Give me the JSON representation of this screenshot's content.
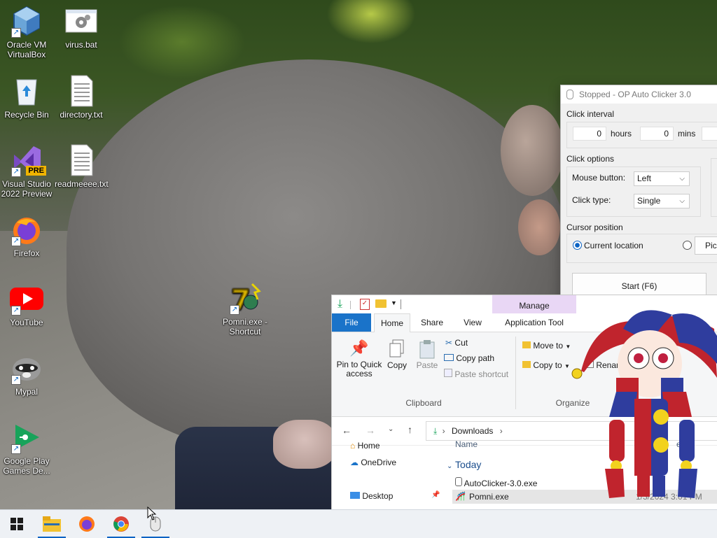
{
  "desktop": {
    "icons": [
      {
        "label": "Oracle VM VirtualBox",
        "icon": "virtualbox-icon"
      },
      {
        "label": "virus.bat",
        "icon": "batch-file-icon"
      },
      {
        "label": "Recycle Bin",
        "icon": "recycle-bin-icon"
      },
      {
        "label": "directory.txt",
        "icon": "text-file-icon"
      },
      {
        "label": "Visual Studio 2022 Preview",
        "icon": "visual-studio-icon"
      },
      {
        "label": "readmeeee.txt",
        "icon": "text-file-icon"
      },
      {
        "label": "Firefox",
        "icon": "firefox-icon"
      },
      {
        "label": "YouTube",
        "icon": "youtube-icon"
      },
      {
        "label": "Pomni.exe - Shortcut",
        "icon": "pomni-exe-icon"
      },
      {
        "label": "Mypal",
        "icon": "mypal-icon"
      },
      {
        "label": "Google Play Games De...",
        "icon": "google-play-games-icon"
      }
    ],
    "vs_badge": "PRE"
  },
  "clicker": {
    "title": "Stopped - OP Auto Clicker 3.0",
    "interval_label": "Click interval",
    "hours_value": "0",
    "hours_label": "hours",
    "mins_value": "0",
    "mins_label": "mins",
    "options_label": "Click options",
    "mouse_button_label": "Mouse button:",
    "mouse_button_value": "Left",
    "click_type_label": "Click type:",
    "click_type_value": "Single",
    "cursor_label": "Cursor position",
    "current_location_label": "Current location",
    "pick_label": "Pick",
    "start_label": "Start (F6)"
  },
  "explorer": {
    "manage_label": "Manage",
    "tabs": [
      "File",
      "Home",
      "Share",
      "View",
      "Application Tools"
    ],
    "tab_visible": [
      "File",
      "Home",
      "Share",
      "View",
      "Application Tool"
    ],
    "clipboard": {
      "pin_label": "Pin to Quick access",
      "copy_label": "Copy",
      "paste_label": "Paste",
      "cut_label": "Cut",
      "copy_path_label": "Copy path",
      "paste_shortcut_label": "Paste shortcut",
      "group_label": "Clipboard"
    },
    "organize": {
      "move_to_label": "Move to",
      "copy_to_label": "Copy to",
      "rename_label": "Renam",
      "group_label": "Organize"
    },
    "address": {
      "folder": "Downloads"
    },
    "nav": {
      "home": "Home",
      "onedrive": "OneDrive",
      "desktop": "Desktop"
    },
    "files": {
      "name_header": "Name",
      "group_today": "Today",
      "items": [
        {
          "name": "AutoClicker-3.0.exe"
        },
        {
          "name": "Pomni.exe"
        }
      ],
      "partial_header": "ed",
      "partial_date": "1/3/2024 3:01 PM"
    }
  },
  "taskbar": {
    "items": [
      "start-windows-icon",
      "file-explorer-icon",
      "firefox-icon",
      "chrome-icon",
      "auto-clicker-icon"
    ]
  },
  "colors": {
    "accent": "#0a62c4",
    "manage_tab": "#e9d7f5",
    "file_tab": "#1a73c9"
  }
}
